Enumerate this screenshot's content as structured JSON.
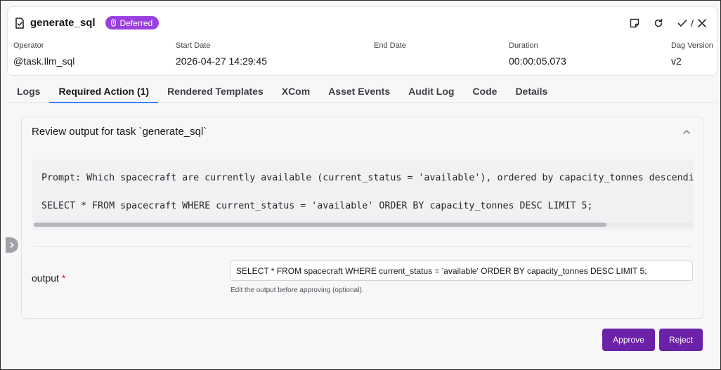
{
  "header": {
    "title": "generate_sql",
    "badge": "Deferred",
    "actions": {
      "slash": "/"
    },
    "meta": [
      {
        "label": "Operator",
        "value": "@task.llm_sql"
      },
      {
        "label": "Start Date",
        "value": "2026-04-27 14:29:45"
      },
      {
        "label": "End Date",
        "value": ""
      },
      {
        "label": "Duration",
        "value": "00:00:05.073"
      },
      {
        "label": "Dag Version",
        "value": "v2"
      }
    ]
  },
  "tabs": [
    "Logs",
    "Required Action (1)",
    "Rendered Templates",
    "XCom",
    "Asset Events",
    "Audit Log",
    "Code",
    "Details"
  ],
  "active_tab": "Required Action (1)",
  "panel": {
    "title": "Review output for task `generate_sql`",
    "code_lines": [
      "Prompt: Which spacecraft are currently available (current_status = 'available'), ordered by capacity_tonnes descending",
      "SELECT * FROM spacecraft WHERE current_status = 'available' ORDER BY capacity_tonnes DESC LIMIT 5;"
    ],
    "scroll_fraction": 0.87,
    "output_label": "output",
    "required_mark": "*",
    "output_value": "SELECT * FROM spacecraft WHERE current_status = 'available' ORDER BY capacity_tonnes DESC LIMIT 5;",
    "helper_text": "Edit the output before approving (optional)."
  },
  "buttons": {
    "approve": "Approve",
    "reject": "Reject"
  },
  "colors": {
    "badge": "#9b3fe0",
    "primary_button": "#6b21a8",
    "active_tab": "#3b82f6",
    "required": "#dc2626"
  },
  "icons": [
    "document-check-icon",
    "clock-icon",
    "note-icon",
    "refresh-icon",
    "check-icon",
    "close-icon",
    "chevron-up-icon",
    "chevron-right-icon"
  ]
}
